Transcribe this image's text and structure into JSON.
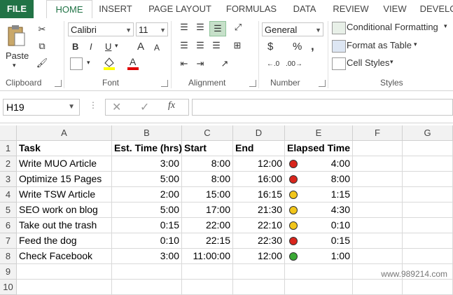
{
  "tabs": [
    "FILE",
    "HOME",
    "INSERT",
    "PAGE LAYOUT",
    "FORMULAS",
    "DATA",
    "REVIEW",
    "VIEW",
    "DEVELO"
  ],
  "clipboard": {
    "paste_label": "Paste",
    "group_label": "Clipboard"
  },
  "font": {
    "name": "Calibri",
    "size": "11",
    "group_label": "Font",
    "bold": "B",
    "italic": "I",
    "underline": "U",
    "grow": "A",
    "shrink": "A"
  },
  "alignment": {
    "group_label": "Alignment"
  },
  "number": {
    "format": "General",
    "group_label": "Number",
    "currency": "$",
    "percent": "%",
    "comma": ","
  },
  "styles": {
    "conditional": "Conditional Formatting",
    "format_table": "Format as Table",
    "cell_styles": "Cell Styles",
    "group_label": "Styles"
  },
  "formula_bar": {
    "name_box": "H19",
    "fx": "fx",
    "formula": ""
  },
  "columns": [
    "A",
    "B",
    "C",
    "D",
    "E",
    "F",
    "G"
  ],
  "rows": [
    "1",
    "2",
    "3",
    "4",
    "5",
    "6",
    "7",
    "8",
    "9",
    "10"
  ],
  "sheet": {
    "header": {
      "task": "Task",
      "est": "Est. Time (hrs)",
      "start": "Start",
      "end": "End",
      "elapsed": "Elapsed Time"
    },
    "data": [
      {
        "task": "Write MUO Article",
        "est": "3:00",
        "start": "8:00",
        "end": "12:00",
        "status": "red",
        "elapsed": "4:00"
      },
      {
        "task": "Optimize 15 Pages",
        "est": "5:00",
        "start": "8:00",
        "end": "16:00",
        "status": "red",
        "elapsed": "8:00"
      },
      {
        "task": "Write TSW Article",
        "est": "2:00",
        "start": "15:00",
        "end": "16:15",
        "status": "yellow",
        "elapsed": "1:15"
      },
      {
        "task": "SEO work on blog",
        "est": "5:00",
        "start": "17:00",
        "end": "21:30",
        "status": "yellow",
        "elapsed": "4:30"
      },
      {
        "task": "Take out the trash",
        "est": "0:15",
        "start": "22:00",
        "end": "22:10",
        "status": "yellow",
        "elapsed": "0:10"
      },
      {
        "task": "Feed the dog",
        "est": "0:10",
        "start": "22:15",
        "end": "22:30",
        "status": "red",
        "elapsed": "0:15"
      },
      {
        "task": "Check Facebook",
        "est": "3:00",
        "start": "11:00:00",
        "end": "12:00",
        "status": "green",
        "elapsed": "1:00"
      }
    ]
  },
  "colors": {
    "red": "#d9251c",
    "yellow": "#f2c61a",
    "green": "#3aa935",
    "accent": "#217346"
  },
  "watermark": "www.989214.com"
}
